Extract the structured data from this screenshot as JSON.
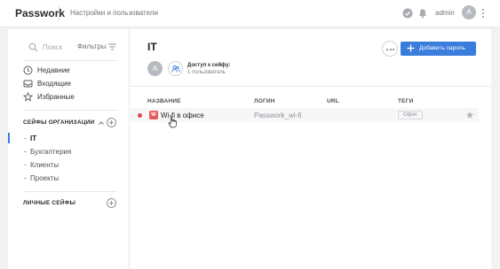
{
  "app": {
    "brand": "Passwork",
    "top_link": "Настройки и пользователи",
    "user_name": "admin",
    "user_initial": "A"
  },
  "sidebar": {
    "search_placeholder": "Поиск",
    "filters_label": "Фильтры",
    "nav": [
      {
        "label": "Недавние",
        "icon": "clock-icon"
      },
      {
        "label": "Входящие",
        "icon": "inbox-icon"
      },
      {
        "label": "Избранные",
        "icon": "star-icon"
      }
    ],
    "org_section_title": "СЕЙФЫ ОРГАНИЗАЦИИ",
    "org_vaults": [
      {
        "label": "IT",
        "active": true
      },
      {
        "label": "Бухгалтерия",
        "active": false
      },
      {
        "label": "Клиенты",
        "active": false
      },
      {
        "label": "Проекты",
        "active": false
      }
    ],
    "personal_section_title": "ЛИЧНЫЕ СЕЙФЫ"
  },
  "main": {
    "vault_title": "IT",
    "add_password_label": "Добавить пароль",
    "owner_initial": "A",
    "access_label": "Доступ к сейфу:",
    "access_count": "1 пользователь",
    "columns": [
      "НАЗВАНИЕ",
      "ЛОГИН",
      "URL",
      "ТЕГИ"
    ],
    "rows": [
      {
        "icon_letter": "W",
        "name": "Wi-fi в офисе",
        "login": "Passwork_wi-fi",
        "url": "",
        "tag": "Офис"
      }
    ]
  },
  "colors": {
    "accent": "#3b7ddd",
    "active_marker": "#3b7ddd",
    "status_dot": "#e04848",
    "item_icon": "#e45a5a"
  }
}
